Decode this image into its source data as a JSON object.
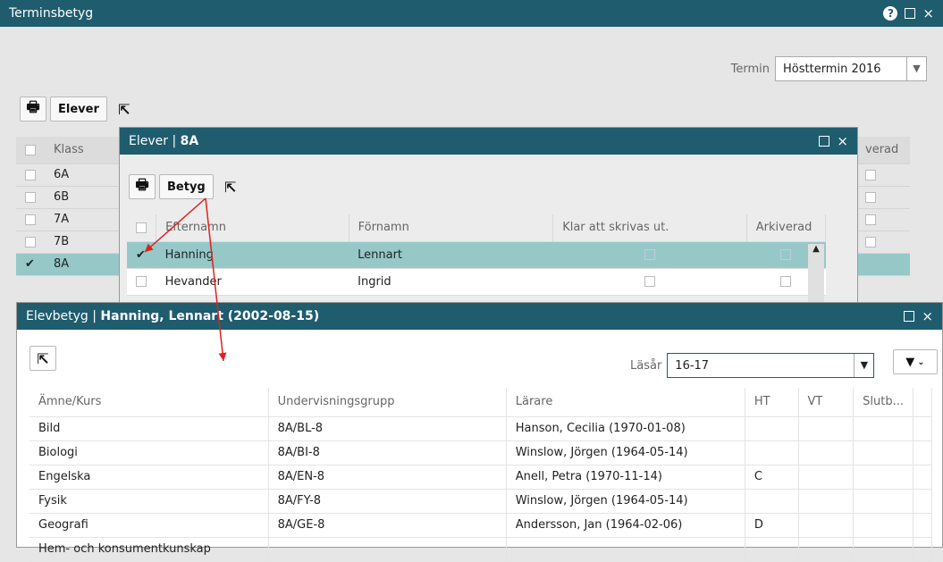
{
  "main": {
    "title": "Terminsbetyg",
    "termin_label": "Termin",
    "termin_value": "Hösttermin 2016",
    "elever_button": "Elever",
    "columns": [
      "Klass",
      "verad"
    ],
    "rows": [
      {
        "klass": "6A",
        "checked": false
      },
      {
        "klass": "6B",
        "checked": false
      },
      {
        "klass": "7A",
        "checked": false
      },
      {
        "klass": "7B",
        "checked": false
      },
      {
        "klass": "8A",
        "checked": true
      }
    ]
  },
  "elever": {
    "title_prefix": "Elever",
    "title_sep": " | ",
    "title_class": "8A",
    "betyg_button": "Betyg",
    "columns": {
      "efternamn": "Efternamn",
      "fornamn": "Förnamn",
      "klar": "Klar att skrivas ut.",
      "arkiverad": "Arkiverad"
    },
    "rows": [
      {
        "efternamn": "Hanning",
        "fornamn": "Lennart",
        "selected": true
      },
      {
        "efternamn": "Hevander",
        "fornamn": "Ingrid",
        "selected": false
      }
    ]
  },
  "elevbetyg": {
    "title_prefix": "Elevbetyg",
    "title_sep": " | ",
    "title_student": "Hanning, Lennart (2002-08-15)",
    "lasar_label": "Läsår",
    "lasar_value": "16-17",
    "columns": {
      "amne": "Ämne/Kurs",
      "grupp": "Undervisningsgrupp",
      "larare": "Lärare",
      "ht": "HT",
      "vt": "VT",
      "slut": "Slutb..."
    },
    "rows": [
      {
        "amne": "Bild",
        "grupp": "8A/BL-8",
        "larare": "Hanson, Cecilia (1970-01-08)",
        "ht": "",
        "vt": "",
        "slut": ""
      },
      {
        "amne": "Biologi",
        "grupp": "8A/BI-8",
        "larare": "Winslow, Jörgen (1964-05-14)",
        "ht": "",
        "vt": "",
        "slut": ""
      },
      {
        "amne": "Engelska",
        "grupp": "8A/EN-8",
        "larare": "Anell, Petra (1970-11-14)",
        "ht": "C",
        "vt": "",
        "slut": ""
      },
      {
        "amne": "Fysik",
        "grupp": "8A/FY-8",
        "larare": "Winslow, Jörgen (1964-05-14)",
        "ht": "",
        "vt": "",
        "slut": ""
      },
      {
        "amne": "Geografi",
        "grupp": "8A/GE-8",
        "larare": "Andersson, Jan (1964-02-06)",
        "ht": "D",
        "vt": "",
        "slut": ""
      },
      {
        "amne": "Hem- och konsumentkunskap",
        "grupp": "",
        "larare": "",
        "ht": "",
        "vt": "",
        "slut": ""
      }
    ]
  },
  "colors": {
    "titlebar": "#1f5c6e",
    "selected_row": "#96c8c8",
    "annotation": "#e02020"
  },
  "icons": {
    "help": "help-icon",
    "maximize": "maximize-icon",
    "close": "close-icon",
    "print": "print-icon",
    "export": "export-icon",
    "filter": "filter-icon",
    "check": "checkmark-icon"
  }
}
